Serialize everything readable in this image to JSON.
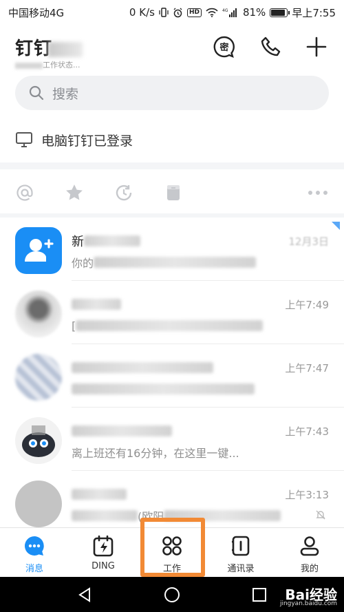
{
  "status_bar": {
    "carrier": "中国移动4G",
    "speed": "0 K/s",
    "network": "4G",
    "battery": "81%",
    "battery_level": 0.81,
    "time": "早上7:55"
  },
  "header": {
    "title": "钉钉",
    "status_suffix": "工作状态..."
  },
  "search": {
    "placeholder": "搜索"
  },
  "pc_login": {
    "text": "电脑钉钉已登录"
  },
  "conversations": [
    {
      "name": "新",
      "preview": "你的",
      "time": "12月3日"
    },
    {
      "name": "",
      "preview": "[",
      "time": "上午7:49"
    },
    {
      "name": "",
      "preview": "",
      "time": "上午7:47"
    },
    {
      "name": "",
      "preview": "离上班还有16分钟，在这里一键...",
      "time": "上午7:43"
    },
    {
      "name": "",
      "preview": "(欧阳",
      "time": "上午3:13"
    }
  ],
  "tabs": [
    {
      "label": "消息"
    },
    {
      "label": "DING"
    },
    {
      "label": "工作"
    },
    {
      "label": "通讯录"
    },
    {
      "label": "我的"
    }
  ],
  "colors": {
    "accent": "#1a8ef5",
    "highlight": "#f28a35"
  },
  "watermark": {
    "text": "Bai经验",
    "sub": "jingyan.baidu.com"
  }
}
